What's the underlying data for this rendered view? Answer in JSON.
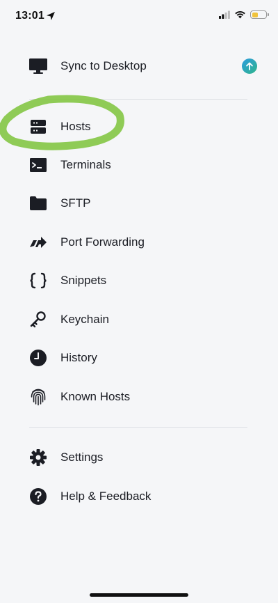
{
  "status_bar": {
    "time": "13:01",
    "battery_level": 0.45,
    "battery_color": "#f0c33c"
  },
  "menu": {
    "top_items": [
      {
        "label": "Sync to Desktop",
        "icon": "desktop-icon",
        "badge_icon": "arrow-up-icon"
      }
    ],
    "main_items": [
      {
        "label": "Hosts",
        "icon": "server-icon"
      },
      {
        "label": "Terminals",
        "icon": "terminal-icon"
      },
      {
        "label": "SFTP",
        "icon": "folder-icon"
      },
      {
        "label": "Port Forwarding",
        "icon": "port-forward-icon"
      },
      {
        "label": "Snippets",
        "icon": "braces-icon"
      },
      {
        "label": "Keychain",
        "icon": "key-icon"
      },
      {
        "label": "History",
        "icon": "clock-icon"
      },
      {
        "label": "Known Hosts",
        "icon": "fingerprint-icon"
      }
    ],
    "bottom_items": [
      {
        "label": "Settings",
        "icon": "gear-icon"
      },
      {
        "label": "Help & Feedback",
        "icon": "help-icon"
      }
    ]
  },
  "colors": {
    "background": "#f5f6f8",
    "text": "#1b1d24",
    "highlight": "#7cc33a",
    "sync_badge_start": "#2c9be0",
    "sync_badge_end": "#2fb58a"
  }
}
